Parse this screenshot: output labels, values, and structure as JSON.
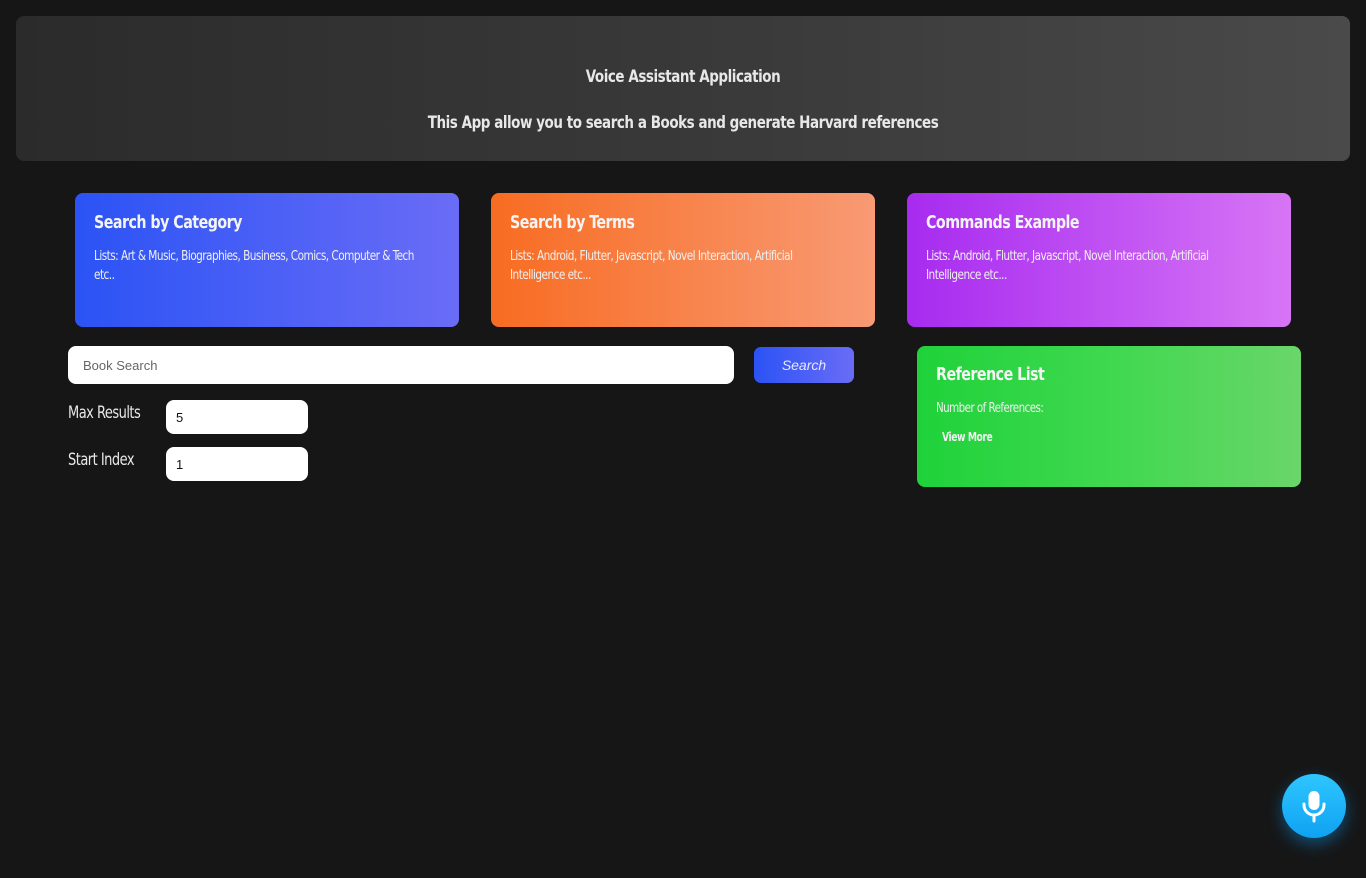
{
  "header": {
    "title": "Voice Assistant Application",
    "subtitle": "This App allow you to search a Books and generate Harvard references"
  },
  "cards": [
    {
      "title": "Search by Category",
      "text": "Lists: Art & Music, Biographies, Business, Comics, Computer & Tech etc..",
      "color": "#2b53f5"
    },
    {
      "title": "Search by Terms",
      "text": "Lists: Android, Flutter, Javascript, Novel Interaction, Artificial Intelligence etc...",
      "color": "#f86c22"
    },
    {
      "title": "Commands Example",
      "text": "Lists: Android, Flutter, Javascript, Novel Interaction, Artificial Intelligence etc...",
      "color": "#a72bf0"
    }
  ],
  "search": {
    "placeholder": "Book Search",
    "value": "",
    "button_label": "Search"
  },
  "fields": {
    "max_results": {
      "label": "Max Results",
      "value": "5"
    },
    "start_index": {
      "label": "Start Index",
      "value": "1"
    }
  },
  "reference_list": {
    "title": "Reference List",
    "count_label": "Number of References:",
    "view_more_label": "View More",
    "color": "#1fd23a"
  },
  "mic": {
    "icon": "microphone-icon",
    "color": "#18b2f8"
  }
}
